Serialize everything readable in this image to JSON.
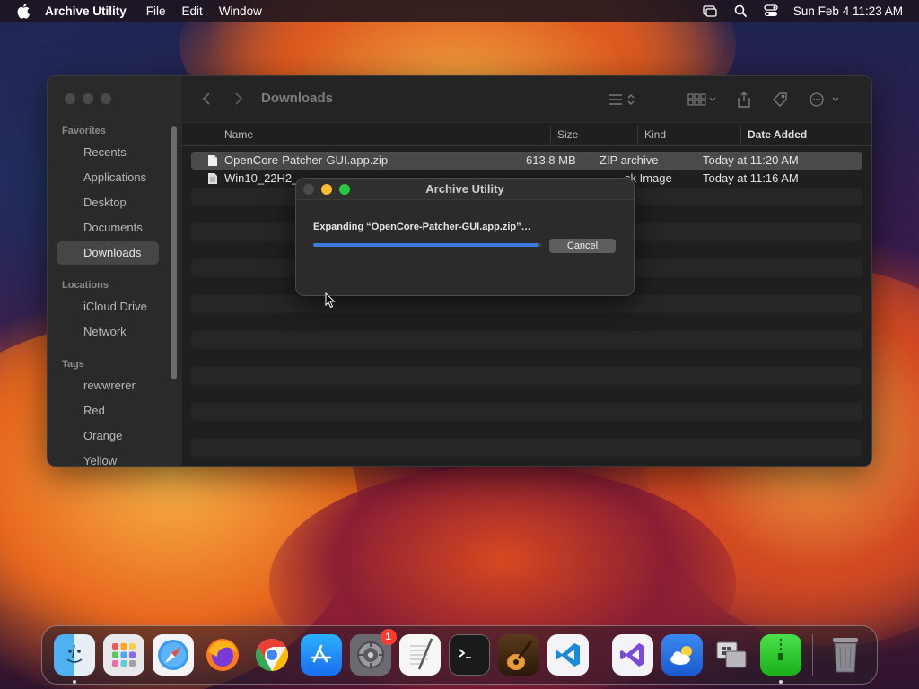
{
  "menubar": {
    "app_name": "Archive Utility",
    "menus": [
      "File",
      "Edit",
      "Window"
    ],
    "clock": "Sun Feb 4  11:23 AM"
  },
  "finder": {
    "title": "Downloads",
    "sidebar": {
      "favorites_label": "Favorites",
      "favorites": [
        "Recents",
        "Applications",
        "Desktop",
        "Documents",
        "Downloads"
      ],
      "locations_label": "Locations",
      "locations": [
        "iCloud Drive",
        "Network"
      ],
      "tags_label": "Tags",
      "tags": [
        "rewwrerer",
        "Red",
        "Orange",
        "Yellow"
      ]
    },
    "columns": {
      "name": "Name",
      "size": "Size",
      "kind": "Kind",
      "date_added": "Date Added"
    },
    "files": [
      {
        "name": "OpenCore-Patcher-GUI.app.zip",
        "size": "613.8 MB",
        "kind": "ZIP archive",
        "date": "Today at 11:20 AM"
      },
      {
        "name": "Win10_22H2_",
        "size": "",
        "kind": "sk Image",
        "date": "Today at 11:16 AM"
      }
    ]
  },
  "dialog": {
    "title": "Archive Utility",
    "message": "Expanding “OpenCore-Patcher-GUI.app.zip”…",
    "cancel_label": "Cancel",
    "progress": 0.99
  },
  "dock": {
    "settings_badge": "1",
    "apps": [
      "finder-icon",
      "launchpad-icon",
      "safari-icon",
      "firefox-icon",
      "chrome-icon",
      "app-store-icon",
      "system-settings-icon",
      "textedit-icon",
      "terminal-icon",
      "garageband-icon",
      "vscode-icon",
      "visual-studio-icon",
      "weather-icon",
      "boot-camp-icon",
      "archive-utility-icon",
      "trash-icon"
    ]
  },
  "colors": {
    "accent": "#3a7de0",
    "traffic_red": "#ff5f57",
    "traffic_yellow": "#febc2e",
    "traffic_green": "#28c840",
    "badge": "#ff3b30"
  }
}
